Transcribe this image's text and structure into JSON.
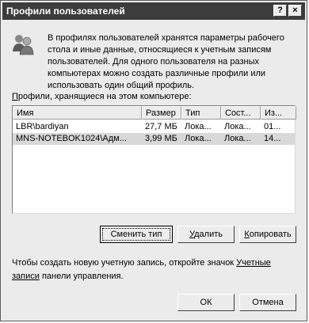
{
  "window": {
    "title": "Профили пользователей",
    "help_label": "?",
    "close_label": "×"
  },
  "description": "В профилях пользователей хранятся параметры рабочего стола и иные данные, относящиеся к учетным записям пользователей. Для одного пользователя на разных компьютерах можно создать различные профили или использовать один общий профиль.",
  "list_label": {
    "underlined": "П",
    "rest": "рофили, хранящиеся на этом компьютере:"
  },
  "table": {
    "columns": [
      "Имя",
      "Размер",
      "Тип",
      "Сост...",
      "Из..."
    ],
    "rows": [
      [
        "LBR\\bardiyan",
        "27,7 МБ",
        "Лока...",
        "Лока...",
        "01..."
      ],
      [
        "MNS-NOTEBOK1024\\Адм...",
        "3,99 МБ",
        "Лока...",
        "Лока...",
        "14..."
      ]
    ]
  },
  "buttons": {
    "change_type": "Сменить тип",
    "delete_u": "У",
    "delete_rest": "далить",
    "copy_u": "К",
    "copy_rest": "опировать",
    "ok": "ОК",
    "cancel": "Отмена"
  },
  "note": {
    "text": "Чтобы создать новую учетную запись, откройте значок ",
    "link": "Учетные записи",
    "tail": " панели управления."
  }
}
